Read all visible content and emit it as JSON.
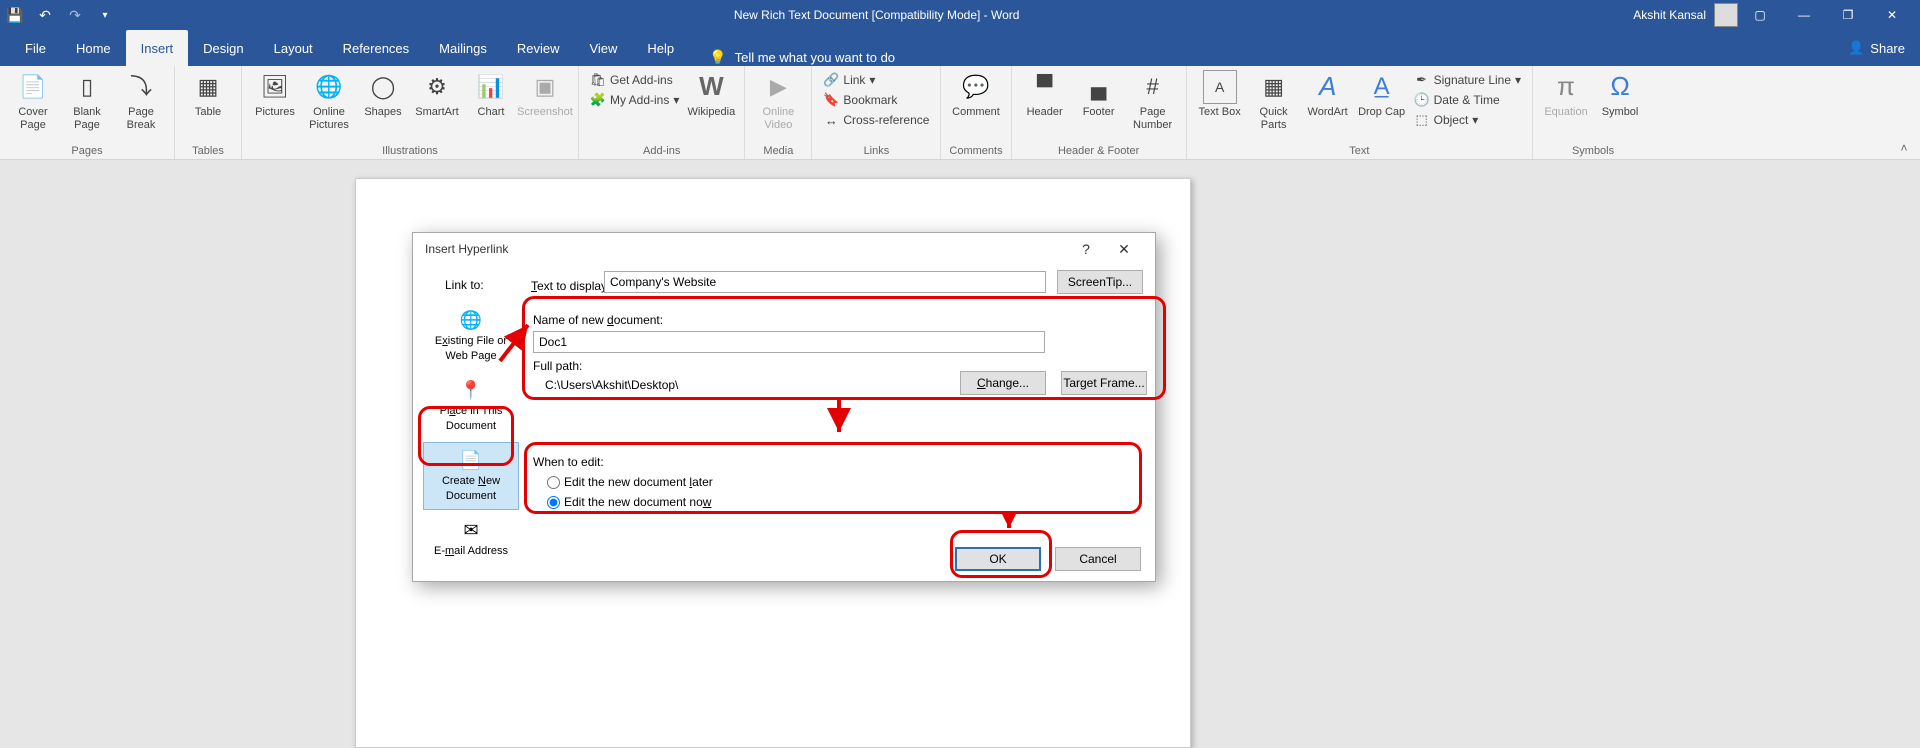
{
  "titlebar": {
    "doc_title": "New Rich Text Document [Compatibility Mode]  -  Word",
    "user_name": "Akshit Kansal"
  },
  "menu": {
    "file": "File",
    "home": "Home",
    "insert": "Insert",
    "design": "Design",
    "layout": "Layout",
    "references": "References",
    "mailings": "Mailings",
    "review": "Review",
    "view": "View",
    "help": "Help",
    "tell_me": "Tell me what you want to do",
    "share": "Share"
  },
  "ribbon": {
    "groups": {
      "pages": "Pages",
      "tables": "Tables",
      "illustrations": "Illustrations",
      "addins": "Add-ins",
      "media": "Media",
      "links": "Links",
      "comments": "Comments",
      "hf": "Header & Footer",
      "text": "Text",
      "symbols": "Symbols"
    },
    "btns": {
      "cover_page": "Cover\nPage",
      "blank_page": "Blank\nPage",
      "page_break": "Page\nBreak",
      "table": "Table",
      "pictures": "Pictures",
      "online_pictures": "Online\nPictures",
      "shapes": "Shapes",
      "smartart": "SmartArt",
      "chart": "Chart",
      "screenshot": "Screenshot",
      "get_addins": "Get Add-ins",
      "my_addins": "My Add-ins",
      "wikipedia": "Wikipedia",
      "online_video": "Online\nVideo",
      "link": "Link",
      "bookmark": "Bookmark",
      "cross_ref": "Cross-reference",
      "comment": "Comment",
      "header": "Header",
      "footer": "Footer",
      "page_number": "Page\nNumber",
      "text_box": "Text\nBox",
      "quick_parts": "Quick\nParts",
      "wordart": "WordArt",
      "drop_cap": "Drop\nCap",
      "sig_line": "Signature Line",
      "date_time": "Date & Time",
      "object": "Object",
      "equation": "Equation",
      "symbol": "Symbol"
    }
  },
  "dialog": {
    "title": "Insert Hyperlink",
    "link_to": "Link to:",
    "linkto_items": {
      "existing": "Existing File or\nWeb Page",
      "place": "Place in This\nDocument",
      "create_new": "Create New\nDocument",
      "email": "E-mail Address"
    },
    "text_to_display_lbl": "Text to display:",
    "text_to_display_val": "Company's Website",
    "screentip": "ScreenTip...",
    "name_new_doc_lbl": "Name of new document:",
    "name_new_doc_val": "Doc1",
    "full_path_lbl": "Full path:",
    "full_path_val": "C:\\Users\\Akshit\\Desktop\\",
    "change": "Change...",
    "target_frame": "Target Frame...",
    "when_to_edit": "When to edit:",
    "edit_later": "Edit the new document later",
    "edit_now": "Edit the new document now",
    "ok": "OK",
    "cancel": "Cancel"
  }
}
